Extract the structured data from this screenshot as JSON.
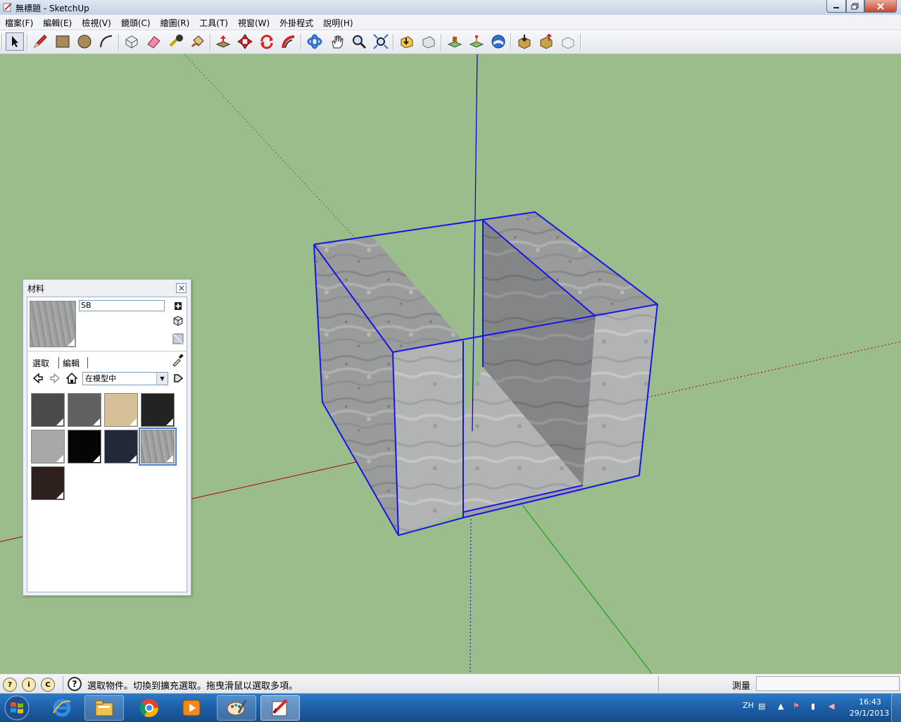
{
  "window": {
    "title": "無標題 - SketchUp",
    "min_icon": "minimize-icon",
    "max_icon": "maximize-icon",
    "close_icon": "close-icon"
  },
  "menu": [
    "檔案(F)",
    "編輯(E)",
    "檢視(V)",
    "鏡頭(C)",
    "繪圖(R)",
    "工具(T)",
    "視窗(W)",
    "外掛程式",
    "說明(H)"
  ],
  "toolbar": {
    "tools": [
      "select-tool",
      "pencil-line-tool",
      "rectangle-tool",
      "circle-tool",
      "arc-tool",
      "make-component-tool",
      "eraser-tool",
      "tape-measure-tool",
      "paint-bucket-tool",
      "push-pull-tool",
      "move-tool",
      "rotate-tool",
      "follow-me-tool",
      "orbit-tool",
      "pan-tool",
      "zoom-tool",
      "zoom-extents-tool",
      "get-models-tool",
      "share-model-tool",
      "add-location-tool",
      "toggle-terrain-tool",
      "preview-google-earth-tool",
      "get-components-tool",
      "share-component-tool",
      "extension-warehouse-tool"
    ]
  },
  "materials_panel": {
    "title": "材料",
    "name_value": "SB",
    "tab_select": "選取",
    "tab_edit": "編輯",
    "library": "在模型中",
    "swatch_colors": [
      "#4a4a4a",
      "#606060",
      "#d6c09a",
      "#232323",
      "#a8a8a8",
      "#050505",
      "#222a3a",
      "texture-concrete",
      "#2e201d"
    ],
    "selected_swatch": 7
  },
  "statusbar": {
    "hint": "選取物件。切換到擴充選取。拖曳滑鼠以選取多項。",
    "measure_label": "測量",
    "measure_value": ""
  },
  "taskbar": {
    "apps": [
      "internet-explorer-icon",
      "file-explorer-icon",
      "chrome-icon",
      "media-player-icon",
      "paint-icon",
      "sketchup-icon"
    ],
    "tray_lang": "ZH",
    "time": "16:43",
    "date": "29/1/2013"
  },
  "colors": {
    "sky_ground": "#9bbd8c",
    "selection_edge": "#1616e6",
    "axis_red": "#b00000",
    "axis_green": "#00a000",
    "axis_blue": "#0000d0"
  }
}
